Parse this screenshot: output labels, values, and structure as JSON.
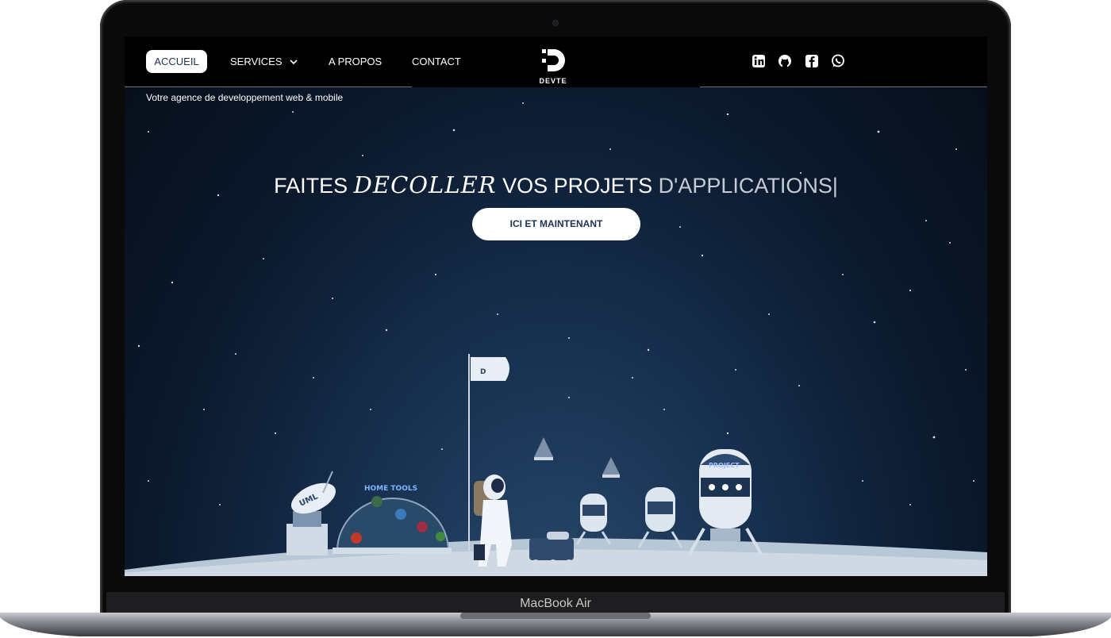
{
  "device_label": "MacBook Air",
  "nav": {
    "home": "ACCUEIL",
    "services": "SERVICES",
    "about": "A PROPOS",
    "contact": "CONTACT"
  },
  "brand": {
    "logo_text": "DEVTE"
  },
  "tagline": "Votre agence de developpement web & mobile",
  "hero": {
    "word1": "FAITES",
    "word2": "DECOLLER",
    "word3": "VOS PROJETS",
    "word4": "D'APPLICATIONS|",
    "cta": "ICI ET MAINTENANT"
  },
  "social_icons": [
    "linkedin-icon",
    "github-icon",
    "facebook-icon",
    "whatsapp-icon"
  ],
  "illustration": {
    "antenna_label": "UML",
    "dome_label": "HOME TOOLS",
    "rocket_label": "PROJECT",
    "flag_logo": "DEVTE"
  },
  "colors": {
    "accent_dark": "#1c3250",
    "sky": "#0c1a2e"
  }
}
